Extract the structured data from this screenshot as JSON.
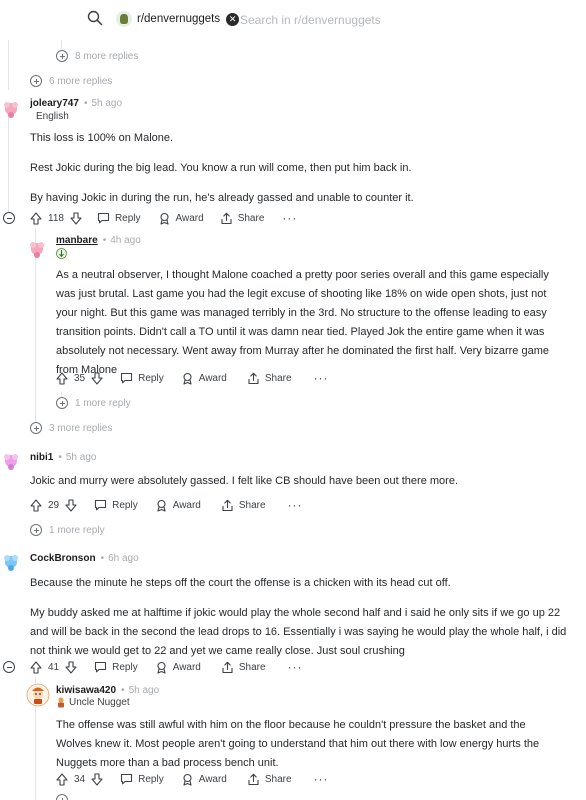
{
  "search": {
    "subreddit": "r/denvernuggets",
    "placeholder": "Search in r/denvernuggets"
  },
  "collapsed": {
    "c0": "8 more replies",
    "c1": "6 more replies",
    "c2": "1 more reply",
    "c3": "3 more replies",
    "c4": "1 more reply"
  },
  "actions": {
    "reply": "Reply",
    "award": "Award",
    "share": "Share",
    "more": "···"
  },
  "comments": [
    {
      "user": "joleary747",
      "time": "5h ago",
      "flair": "English",
      "paragraphs": [
        "This loss is 100% on Malone.",
        "Rest Jokic during the big lead. You know a run will come, then put him back in.",
        "By having Jokic in during the run, he's already gassed and unable to counter it."
      ],
      "votes": "118"
    },
    {
      "user": "manbare",
      "time": "4h ago",
      "paragraphs": [
        "As a neutral observer, I thought Malone coached a pretty poor series overall and this game especially was just brutal. Last game you had the legit excuse of shooting like 18% on wide open shots, just not your night. But this game was managed terribly in the 3rd. No structure to the offense leading to easy transition points. Didn't call a TO until it was damn near tied. Played Jok the entire game when it was absolutely not necessary. Went away from Murray after he dominated the first half. Very bizarre game from Malone"
      ],
      "votes": "35"
    },
    {
      "user": "nibi1",
      "time": "5h ago",
      "paragraphs": [
        "Jokic and murry were absolutely gassed. I felt like CB should have been out there more."
      ],
      "votes": "29"
    },
    {
      "user": "CockBronson",
      "time": "6h ago",
      "paragraphs": [
        "Because the minute he steps off the court the offense is a chicken with its head cut off.",
        "My buddy asked me at halftime if jokic would play the whole second half and i said he only sits if we go up 22 and will be back in the second the lead drops to 16. Essentially i was saying he would play the whole half, i did not think we would get to 22 and yet we came really close. Just soul crushing"
      ],
      "votes": "41"
    },
    {
      "user": "kiwisawa420",
      "time": "5h ago",
      "flair": "Uncle Nugget",
      "paragraphs": [
        "The offense was still awful with him on the floor because he couldn't pressure the basket and the Wolves knew it. Most people aren't going to understand that him out there with low energy hurts the Nuggets more than a bad process bench unit."
      ],
      "votes": "34"
    }
  ]
}
